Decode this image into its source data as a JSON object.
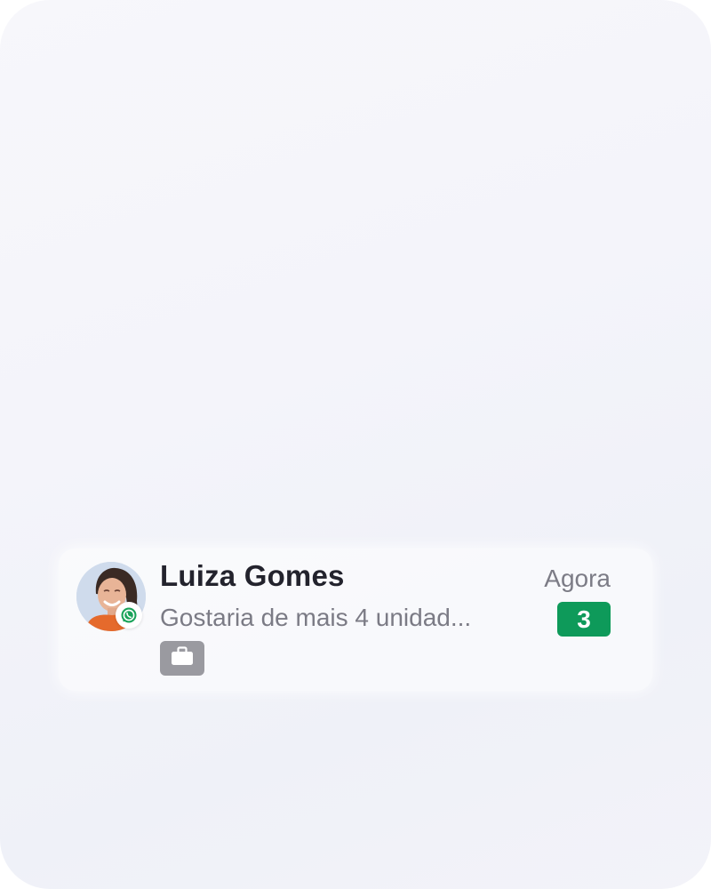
{
  "conversation": {
    "contact_name": "Luiza Gomes",
    "time": "Agora",
    "preview": "Gostaria de mais 4 unidad...",
    "unread_count": "3",
    "channel_icon": "whatsapp-icon",
    "tag_icon": "briefcase-icon"
  },
  "colors": {
    "unread_badge": "#0e9a5a",
    "whatsapp": "#1aa35a",
    "tag_background": "#9a9aa0"
  }
}
